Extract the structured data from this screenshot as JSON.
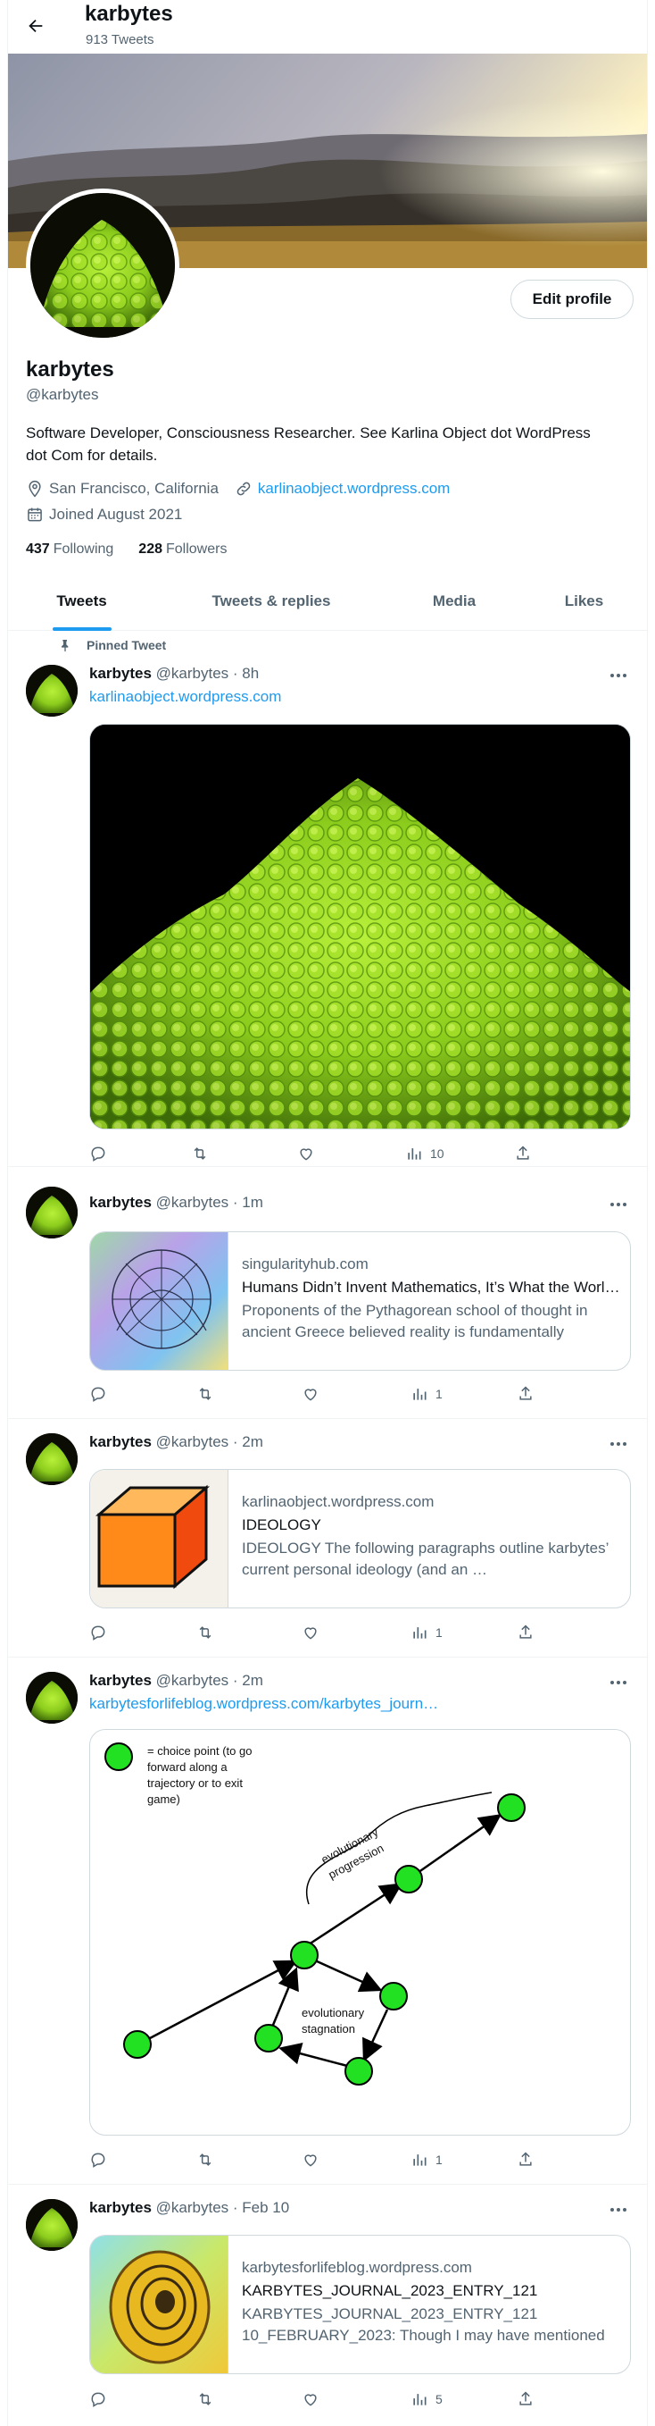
{
  "header": {
    "back_label": "Back",
    "name": "karbytes",
    "tweet_count": "913 Tweets"
  },
  "profile": {
    "edit_label": "Edit profile",
    "name": "karbytes",
    "handle": "@karbytes",
    "bio": "Software Developer, Consciousness Researcher. See Karlina Object dot WordPress dot Com for details.",
    "location": "San Francisco, California",
    "website": "karlinaobject.wordpress.com",
    "joined": "Joined August 2021",
    "following_count": "437",
    "following_label": "Following",
    "followers_count": "228",
    "followers_label": "Followers"
  },
  "tabs": [
    {
      "label": "Tweets",
      "active": true
    },
    {
      "label": "Tweets & replies",
      "active": false
    },
    {
      "label": "Media",
      "active": false
    },
    {
      "label": "Likes",
      "active": false
    }
  ],
  "tweets": [
    {
      "pinned_label": "Pinned Tweet",
      "name": "karbytes",
      "meta": "@karbytes · 8h",
      "link": "karlinaobject.wordpress.com",
      "views": "10"
    },
    {
      "name": "karbytes",
      "meta": "@karbytes · 1m",
      "card": {
        "domain": "singularityhub.com",
        "title": "Humans Didn’t Invent Mathematics, It’s What the World Is Made Of",
        "description": "Proponents of the Pythagorean school of thought in ancient Greece believed reality is fundamentally mathematical."
      },
      "views": "1"
    },
    {
      "name": "karbytes",
      "meta": "@karbytes · 2m",
      "card": {
        "domain": "karlinaobject.wordpress.com",
        "title": "IDEOLOGY",
        "description": "IDEOLOGY The following paragraphs outline karbytes’ current personal ideology (and an …"
      },
      "views": "1"
    },
    {
      "name": "karbytes",
      "meta": "@karbytes · 2m",
      "link": "karbytesforlifeblog.wordpress.com/karbytes_journ…",
      "diagram": {
        "legend": [
          "= choice point (to go",
          "forward along a",
          "trajectory or to exit",
          "game)"
        ],
        "progression": [
          "evolutionary",
          "progression"
        ],
        "stagnation": [
          "evolutionary",
          "stagnation"
        ]
      },
      "views": "1"
    },
    {
      "name": "karbytes",
      "meta": "@karbytes · Feb 10",
      "card": {
        "domain": "karbytesforlifeblog.wordpress.com",
        "title": "KARBYTES_JOURNAL_2023_ENTRY_121",
        "description": "KARBYTES_JOURNAL_2023_ENTRY_121 10_FEBRUARY_2023: Though I may have mentioned this before…"
      },
      "views": "5"
    }
  ],
  "colors": {
    "accent": "#1d9bf0",
    "text": "#0f1419",
    "muted": "#536471",
    "border": "#cfd9de",
    "node": "#22e022"
  },
  "icons": [
    "arrow-left-icon",
    "location-pin-icon",
    "link-icon",
    "calendar-icon",
    "pin-icon",
    "more-icon",
    "reply-icon",
    "retweet-icon",
    "like-icon",
    "views-icon",
    "share-icon"
  ]
}
